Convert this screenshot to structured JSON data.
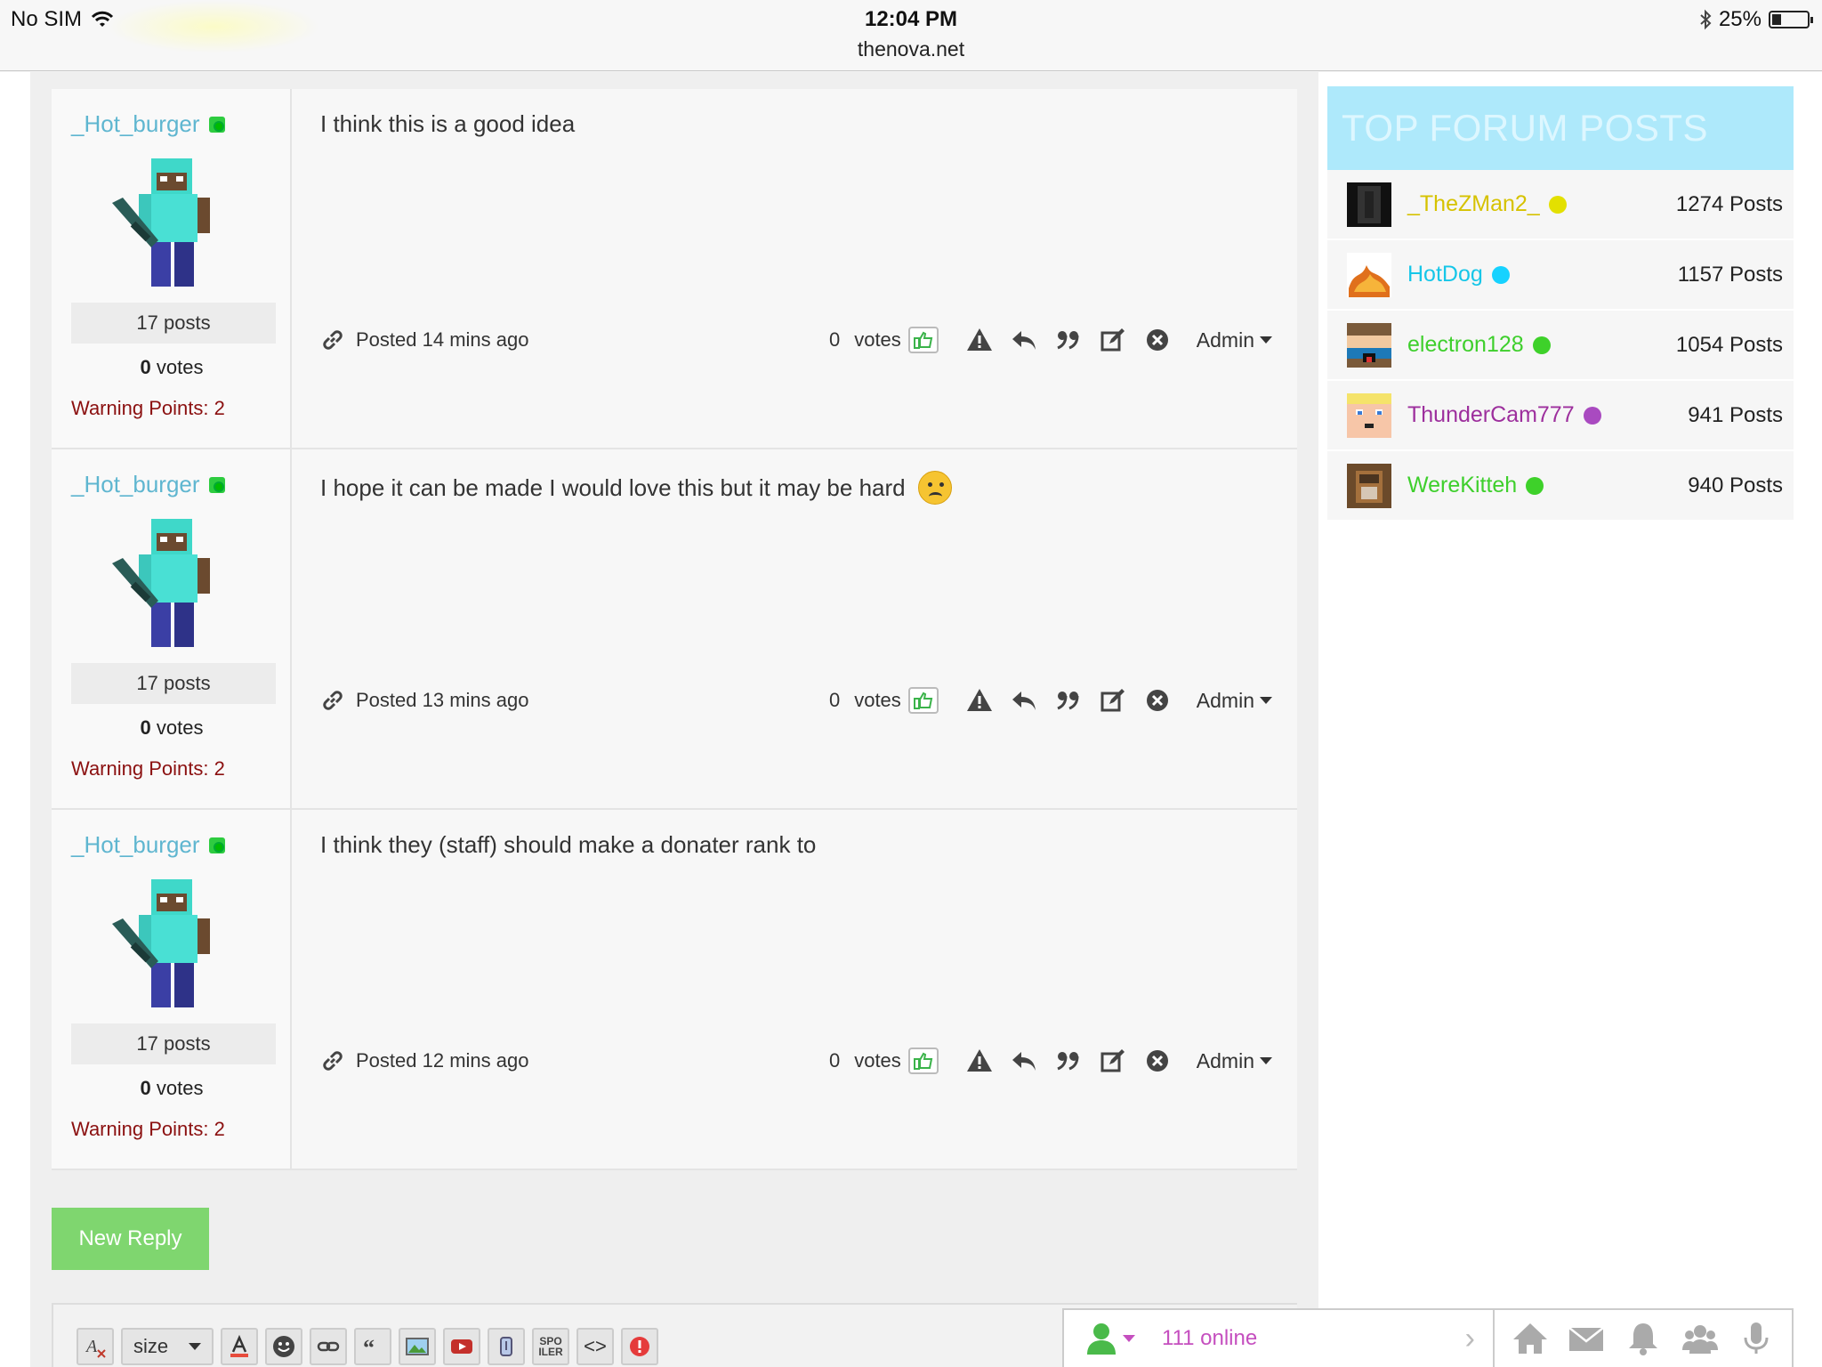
{
  "status": {
    "carrier": "No SIM",
    "time": "12:04 PM",
    "url": "thenova.net",
    "battery": "25%",
    "battery_level": 0.25
  },
  "posts": [
    {
      "username": "_Hot_burger",
      "post_count": "17 posts",
      "votes_num": "0",
      "votes_word": "votes",
      "warning": "Warning Points: 2",
      "message": "I think this is a good idea",
      "posted": "Posted 14 mins ago",
      "vote_count": "0",
      "vote_label": "votes",
      "admin": "Admin",
      "has_emoji": false
    },
    {
      "username": "_Hot_burger",
      "post_count": "17 posts",
      "votes_num": "0",
      "votes_word": "votes",
      "warning": "Warning Points: 2",
      "message": "I hope it can be made I would love this but it may be hard",
      "posted": "Posted 13 mins ago",
      "vote_count": "0",
      "vote_label": "votes",
      "admin": "Admin",
      "has_emoji": true
    },
    {
      "username": "_Hot_burger",
      "post_count": "17 posts",
      "votes_num": "0",
      "votes_word": "votes",
      "warning": "Warning Points: 2",
      "message": "I think they (staff) should make a donater rank to",
      "posted": "Posted 12 mins ago",
      "vote_count": "0",
      "vote_label": "votes",
      "admin": "Admin",
      "has_emoji": false
    }
  ],
  "new_reply": "New Reply",
  "editor": {
    "size_label": "size",
    "spoiler_line1": "SPO",
    "spoiler_line2": "ILER",
    "code_label": "<>"
  },
  "online": {
    "count": "111 online"
  },
  "widget": {
    "title": "TOP FORUM POSTS",
    "rows": [
      {
        "name": "_TheZMan2_",
        "posts": "1274 Posts",
        "color": "#d6c200",
        "dot": "#e3e000"
      },
      {
        "name": "HotDog",
        "posts": "1157 Posts",
        "color": "#16c6e8",
        "dot": "#16d2ff"
      },
      {
        "name": "electron128",
        "posts": "1054 Posts",
        "color": "#3ecf2c",
        "dot": "#3ed12a"
      },
      {
        "name": "ThunderCam777",
        "posts": "941 Posts",
        "color": "#9d2f9d",
        "dot": "#a94ac0"
      },
      {
        "name": "WereKitteh",
        "posts": "940 Posts",
        "color": "#3ecf2c",
        "dot": "#3ed12a"
      }
    ]
  },
  "colors": {
    "username": "#5fb6d0",
    "warning": "#8b1010",
    "new_reply_bg": "#7fd66f",
    "widget_header_bg": "#aee9fb",
    "online_text": "#c54fbf"
  }
}
